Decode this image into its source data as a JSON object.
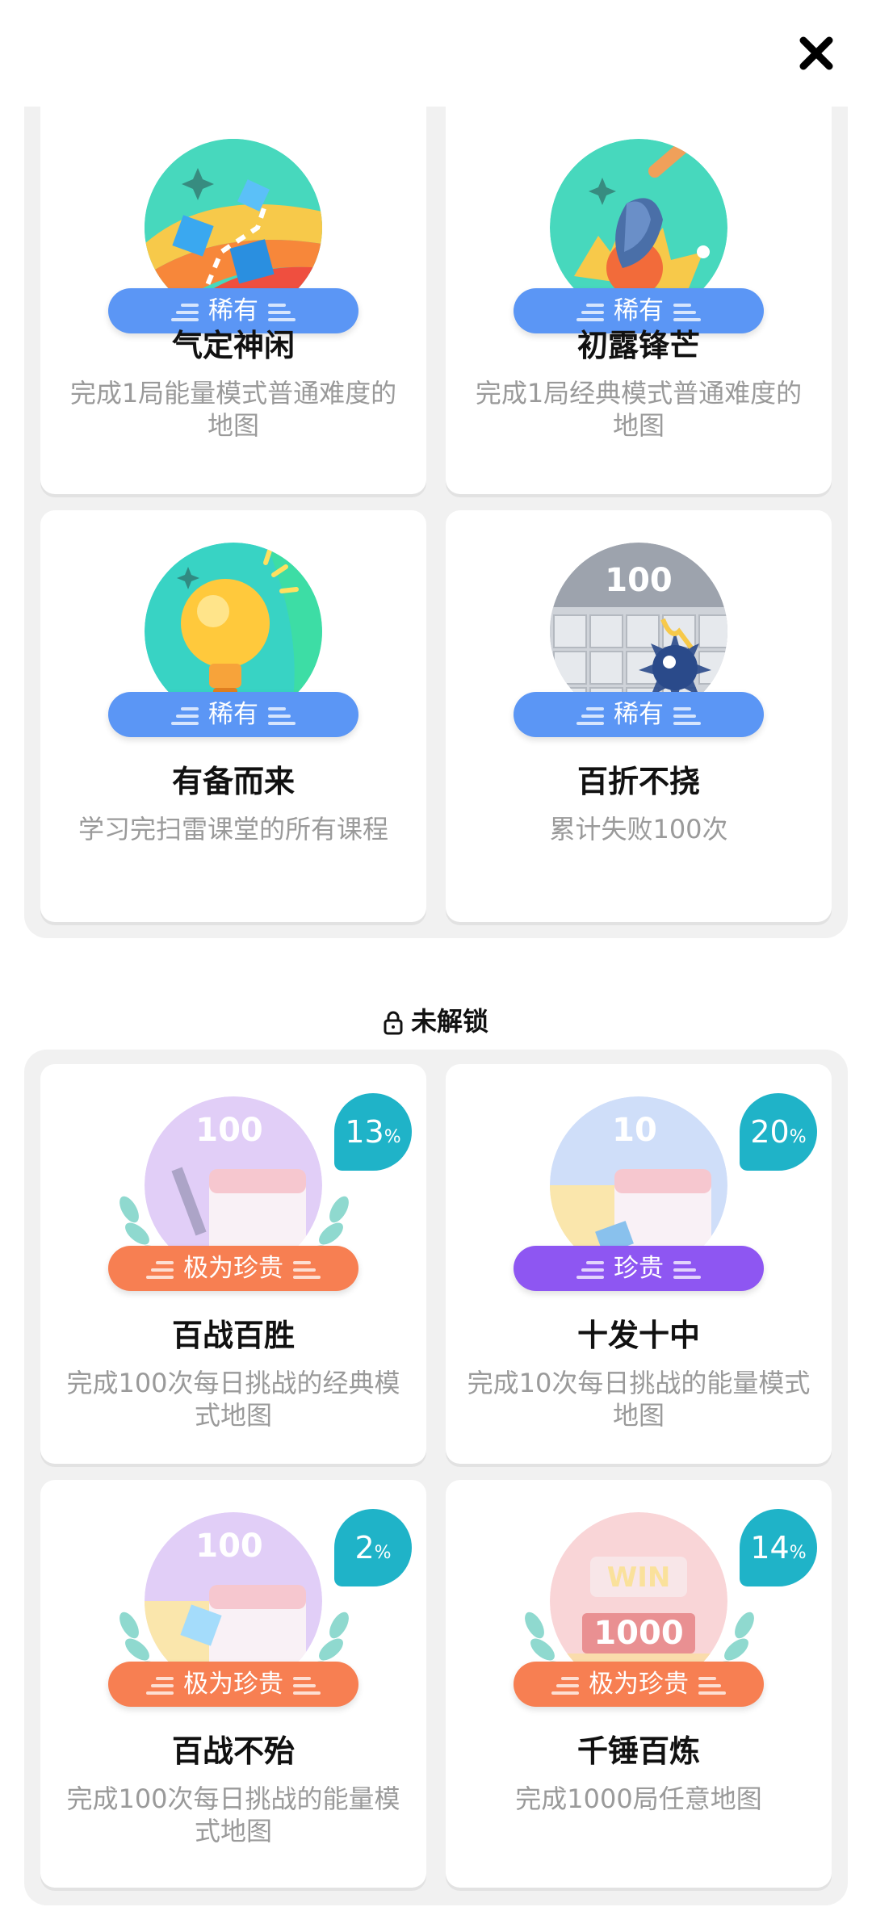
{
  "close_icon": "close-icon",
  "unlocked": {
    "cards": [
      {
        "title": "气定神闲",
        "desc": "完成1局能量模式普通难度的地图",
        "rarity": "稀有",
        "icon": "rainbow-road-icon"
      },
      {
        "title": "初露锋芒",
        "desc": "完成1局经典模式普通难度的地图",
        "rarity": "稀有",
        "icon": "shovel-icon"
      },
      {
        "title": "有备而来",
        "desc": "学习完扫雷课堂的所有课程",
        "rarity": "稀有",
        "icon": "lightbulb-icon"
      },
      {
        "title": "百折不挠",
        "desc": "累计失败100次",
        "rarity": "稀有",
        "icon": "mine-icon",
        "badge_text": "100"
      }
    ]
  },
  "locked_section": {
    "label": "未解锁"
  },
  "locked": {
    "cards": [
      {
        "title": "百战百胜",
        "desc": "完成100次每日挑战的经典模式地图",
        "rarity": "极为珍贵",
        "progress": "13",
        "unit": "%",
        "badge_text": "100",
        "icon": "calendar-icon"
      },
      {
        "title": "十发十中",
        "desc": "完成10次每日挑战的能量模式地图",
        "rarity": "珍贵",
        "progress": "20",
        "unit": "%",
        "badge_text": "10",
        "icon": "calendar-icon"
      },
      {
        "title": "百战不殆",
        "desc": "完成100次每日挑战的能量模式地图",
        "rarity": "极为珍贵",
        "progress": "2",
        "unit": "%",
        "badge_text": "100",
        "icon": "calendar-icon"
      },
      {
        "title": "千锤百炼",
        "desc": "完成1000局任意地图",
        "rarity": "极为珍贵",
        "progress": "14",
        "unit": "%",
        "badge_text": "1000",
        "badge_text2": "WIN",
        "icon": "trophy-icon"
      }
    ]
  },
  "colors": {
    "rare": "#5b96f5",
    "precious": "#8e56f2",
    "very_precious": "#f77f52",
    "progress": "#1fb3c8"
  }
}
